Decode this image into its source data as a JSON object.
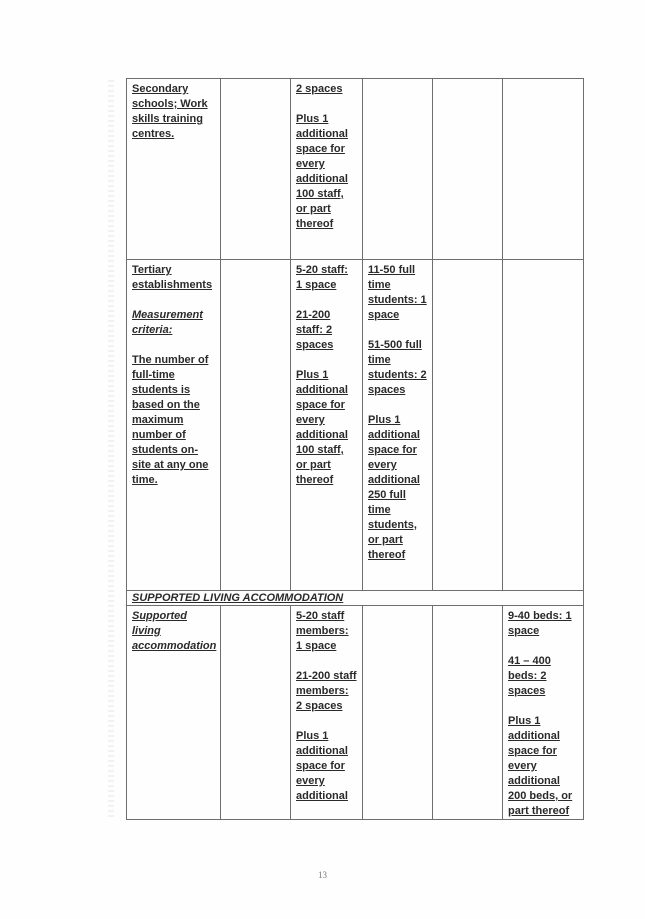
{
  "document": {
    "page_number": "13",
    "rows": [
      {
        "label_lines": [
          "Secondary schools; Work skills training centres."
        ],
        "col2": [],
        "col3": [
          "2 spaces",
          "",
          "Plus 1 additional space for every additional 100 staff, or part thereof"
        ],
        "col4": [],
        "col5": [],
        "col6": []
      },
      {
        "label": "Tertiary establishments",
        "criteria_title": "Measurement criteria:",
        "criteria_text": "The number of full-time students is based on the maximum number of students on-site at any one time.",
        "col3": [
          "5-20 staff: 1 space",
          "21-200 staff: 2 spaces",
          "Plus 1 additional space for every additional 100 staff, or part thereof"
        ],
        "col4": [
          "11-50 full time students: 1 space",
          "51-500 full time students: 2 spaces",
          "Plus 1 additional space for every additional 250 full time students, or part thereof"
        ]
      }
    ],
    "section_header": "SUPPORTED LIVING ACCOMMODATION",
    "supported": {
      "label": "Supported living accommodation",
      "col3": [
        "5-20 staff members: 1 space",
        "21-200 staff members: 2 spaces",
        "Plus 1 additional space for every additional"
      ],
      "col6": [
        "9-40 beds: 1 space",
        "41 – 400 beds: 2 spaces",
        "Plus 1 additional space for every additional 200 beds, or part thereof"
      ]
    }
  }
}
